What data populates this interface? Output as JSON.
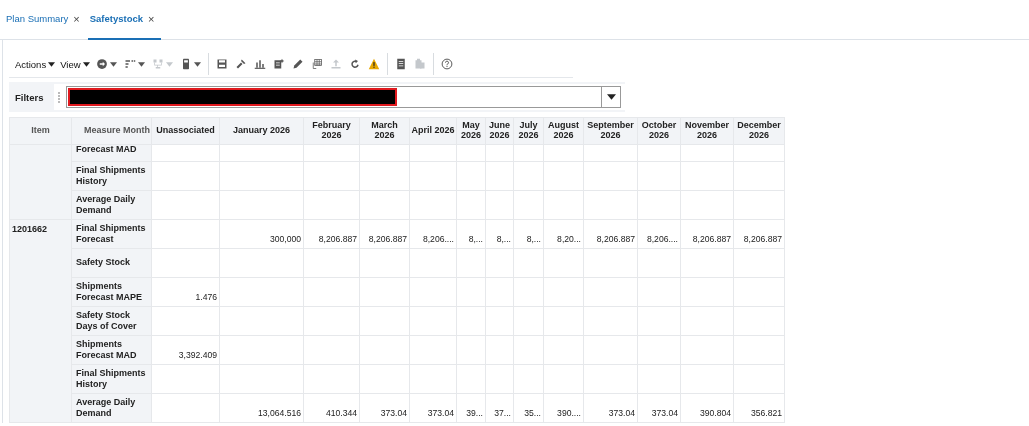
{
  "tabs": [
    {
      "label": "Plan Summary",
      "selected": false,
      "close": "×"
    },
    {
      "label": "Safetystock",
      "selected": true,
      "close": "×"
    }
  ],
  "toolbar": {
    "menus": [
      {
        "label": "Actions"
      },
      {
        "label": "View"
      }
    ],
    "icon_buttons": [
      {
        "kind": "go",
        "disabled": false,
        "dropdown": true
      },
      {
        "kind": "layout",
        "disabled": false,
        "dropdown": true
      },
      {
        "kind": "hierarchy",
        "disabled": true,
        "dropdown": true
      },
      {
        "kind": "calculator",
        "disabled": false,
        "dropdown": true
      },
      {
        "kind": "sep"
      },
      {
        "kind": "save",
        "disabled": false
      },
      {
        "kind": "tools",
        "disabled": false
      },
      {
        "kind": "chart",
        "disabled": false
      },
      {
        "kind": "sheet",
        "disabled": false
      },
      {
        "kind": "pencil",
        "disabled": false
      },
      {
        "kind": "grid",
        "disabled": false
      },
      {
        "kind": "upload",
        "disabled": true
      },
      {
        "kind": "refresh",
        "disabled": false
      },
      {
        "kind": "warning",
        "disabled": false
      },
      {
        "kind": "sep"
      },
      {
        "kind": "document",
        "disabled": false
      },
      {
        "kind": "clipboard",
        "disabled": true
      },
      {
        "kind": "sep"
      },
      {
        "kind": "help",
        "disabled": false
      }
    ]
  },
  "filters": {
    "label": "Filters",
    "redacted": true
  },
  "table": {
    "columns": [
      "Item",
      "Measure",
      "Month",
      "Unassociated",
      "January 2026",
      "February 2026",
      "March 2026",
      "April 2026",
      "May 2026",
      "June 2026",
      "July 2026",
      "August 2026",
      "September 2026",
      "October 2026",
      "November 2026",
      "December 2026"
    ],
    "groups": [
      {
        "rows": [
          {
            "measure": "Forecast MAD",
            "partial": true,
            "values": [
              {
                "empty": true
              },
              {
                "empty": true
              },
              {
                "empty": true
              },
              {
                "empty": true
              },
              {
                "empty": true
              },
              {
                "empty": true
              },
              {
                "empty": true
              },
              {
                "empty": true
              },
              {
                "empty": true
              },
              {
                "empty": true
              },
              {
                "empty": true
              },
              {
                "empty": true
              },
              {
                "empty": true
              }
            ]
          },
          {
            "measure": "Final Shipments History",
            "partial": false,
            "values": [
              {
                "empty": true
              },
              {
                "empty": true
              },
              {
                "empty": true
              },
              {
                "empty": true
              },
              {
                "empty": true
              },
              {
                "empty": true
              },
              {
                "empty": true
              },
              {
                "empty": true
              },
              {
                "empty": true
              },
              {
                "empty": true
              },
              {
                "empty": true
              },
              {
                "empty": true
              },
              {
                "empty": true
              }
            ]
          },
          {
            "measure": "Average Daily Demand",
            "partial": false,
            "values": [
              {
                "empty": true
              },
              {
                "empty": true
              },
              {
                "empty": true
              },
              {
                "empty": true
              },
              {
                "empty": true
              },
              {
                "empty": true
              },
              {
                "empty": true
              },
              {
                "empty": true
              },
              {
                "empty": true
              },
              {
                "empty": true
              },
              {
                "empty": true
              },
              {
                "empty": true
              },
              {
                "empty": true
              }
            ]
          }
        ]
      },
      {
        "item": "1201662",
        "rows": [
          {
            "measure": "Final Shipments Forecast",
            "partial": false,
            "values": [
              {
                "empty": true
              },
              {
                "text": "300,000"
              },
              {
                "text": "8,206.887"
              },
              {
                "text": "8,206.887"
              },
              {
                "text": "8,206...."
              },
              {
                "text": "8,..."
              },
              {
                "text": "8,..."
              },
              {
                "text": "8,..."
              },
              {
                "text": "8,20..."
              },
              {
                "text": "8,206.887"
              },
              {
                "text": "8,206...."
              },
              {
                "text": "8,206.887"
              },
              {
                "text": "8,206.887"
              }
            ]
          },
          {
            "measure": "Safety Stock",
            "partial": false,
            "values": [
              {
                "empty": true
              },
              {
                "empty": true
              },
              {
                "empty": true
              },
              {
                "empty": true
              },
              {
                "empty": true
              },
              {
                "empty": true
              },
              {
                "empty": true
              },
              {
                "empty": true
              },
              {
                "empty": true
              },
              {
                "empty": true
              },
              {
                "empty": true
              },
              {
                "empty": true
              },
              {
                "empty": true
              }
            ]
          },
          {
            "measure": "Shipments Forecast MAPE",
            "partial": false,
            "values": [
              {
                "text": "1.476"
              },
              {
                "empty": true
              },
              {
                "empty": true
              },
              {
                "empty": true
              },
              {
                "empty": true
              },
              {
                "empty": true
              },
              {
                "empty": true
              },
              {
                "empty": true
              },
              {
                "empty": true
              },
              {
                "empty": true
              },
              {
                "empty": true
              },
              {
                "empty": true
              },
              {
                "empty": true
              }
            ]
          },
          {
            "measure": "Safety Stock Days of Cover",
            "partial": false,
            "values": [
              {
                "empty": true
              },
              {
                "empty": true
              },
              {
                "empty": true
              },
              {
                "empty": true
              },
              {
                "empty": true
              },
              {
                "empty": true
              },
              {
                "empty": true
              },
              {
                "empty": true
              },
              {
                "empty": true
              },
              {
                "empty": true
              },
              {
                "empty": true
              },
              {
                "empty": true
              },
              {
                "empty": true
              }
            ]
          },
          {
            "measure": "Shipments Forecast MAD",
            "partial": false,
            "values": [
              {
                "text": "3,392.409"
              },
              {
                "empty": true
              },
              {
                "empty": true
              },
              {
                "empty": true
              },
              {
                "empty": true
              },
              {
                "empty": true
              },
              {
                "empty": true
              },
              {
                "empty": true
              },
              {
                "empty": true
              },
              {
                "empty": true
              },
              {
                "empty": true
              },
              {
                "empty": true
              },
              {
                "empty": true
              }
            ]
          },
          {
            "measure": "Final Shipments History",
            "partial": false,
            "values": [
              {
                "empty": true
              },
              {
                "empty": true
              },
              {
                "empty": true
              },
              {
                "empty": true
              },
              {
                "empty": true
              },
              {
                "empty": true
              },
              {
                "empty": true
              },
              {
                "empty": true
              },
              {
                "empty": true
              },
              {
                "empty": true
              },
              {
                "empty": true
              },
              {
                "empty": true
              },
              {
                "empty": true
              }
            ]
          },
          {
            "measure": "Average Daily Demand",
            "partial": false,
            "values": [
              {
                "empty": true
              },
              {
                "text": "13,064.516"
              },
              {
                "text": "410.344"
              },
              {
                "text": "373.04"
              },
              {
                "text": "373.04"
              },
              {
                "text": "39..."
              },
              {
                "text": "37..."
              },
              {
                "text": "35..."
              },
              {
                "text": "390...."
              },
              {
                "text": "373.04"
              },
              {
                "text": "373.04"
              },
              {
                "text": "390.804"
              },
              {
                "text": "356.821"
              }
            ]
          }
        ]
      }
    ]
  }
}
